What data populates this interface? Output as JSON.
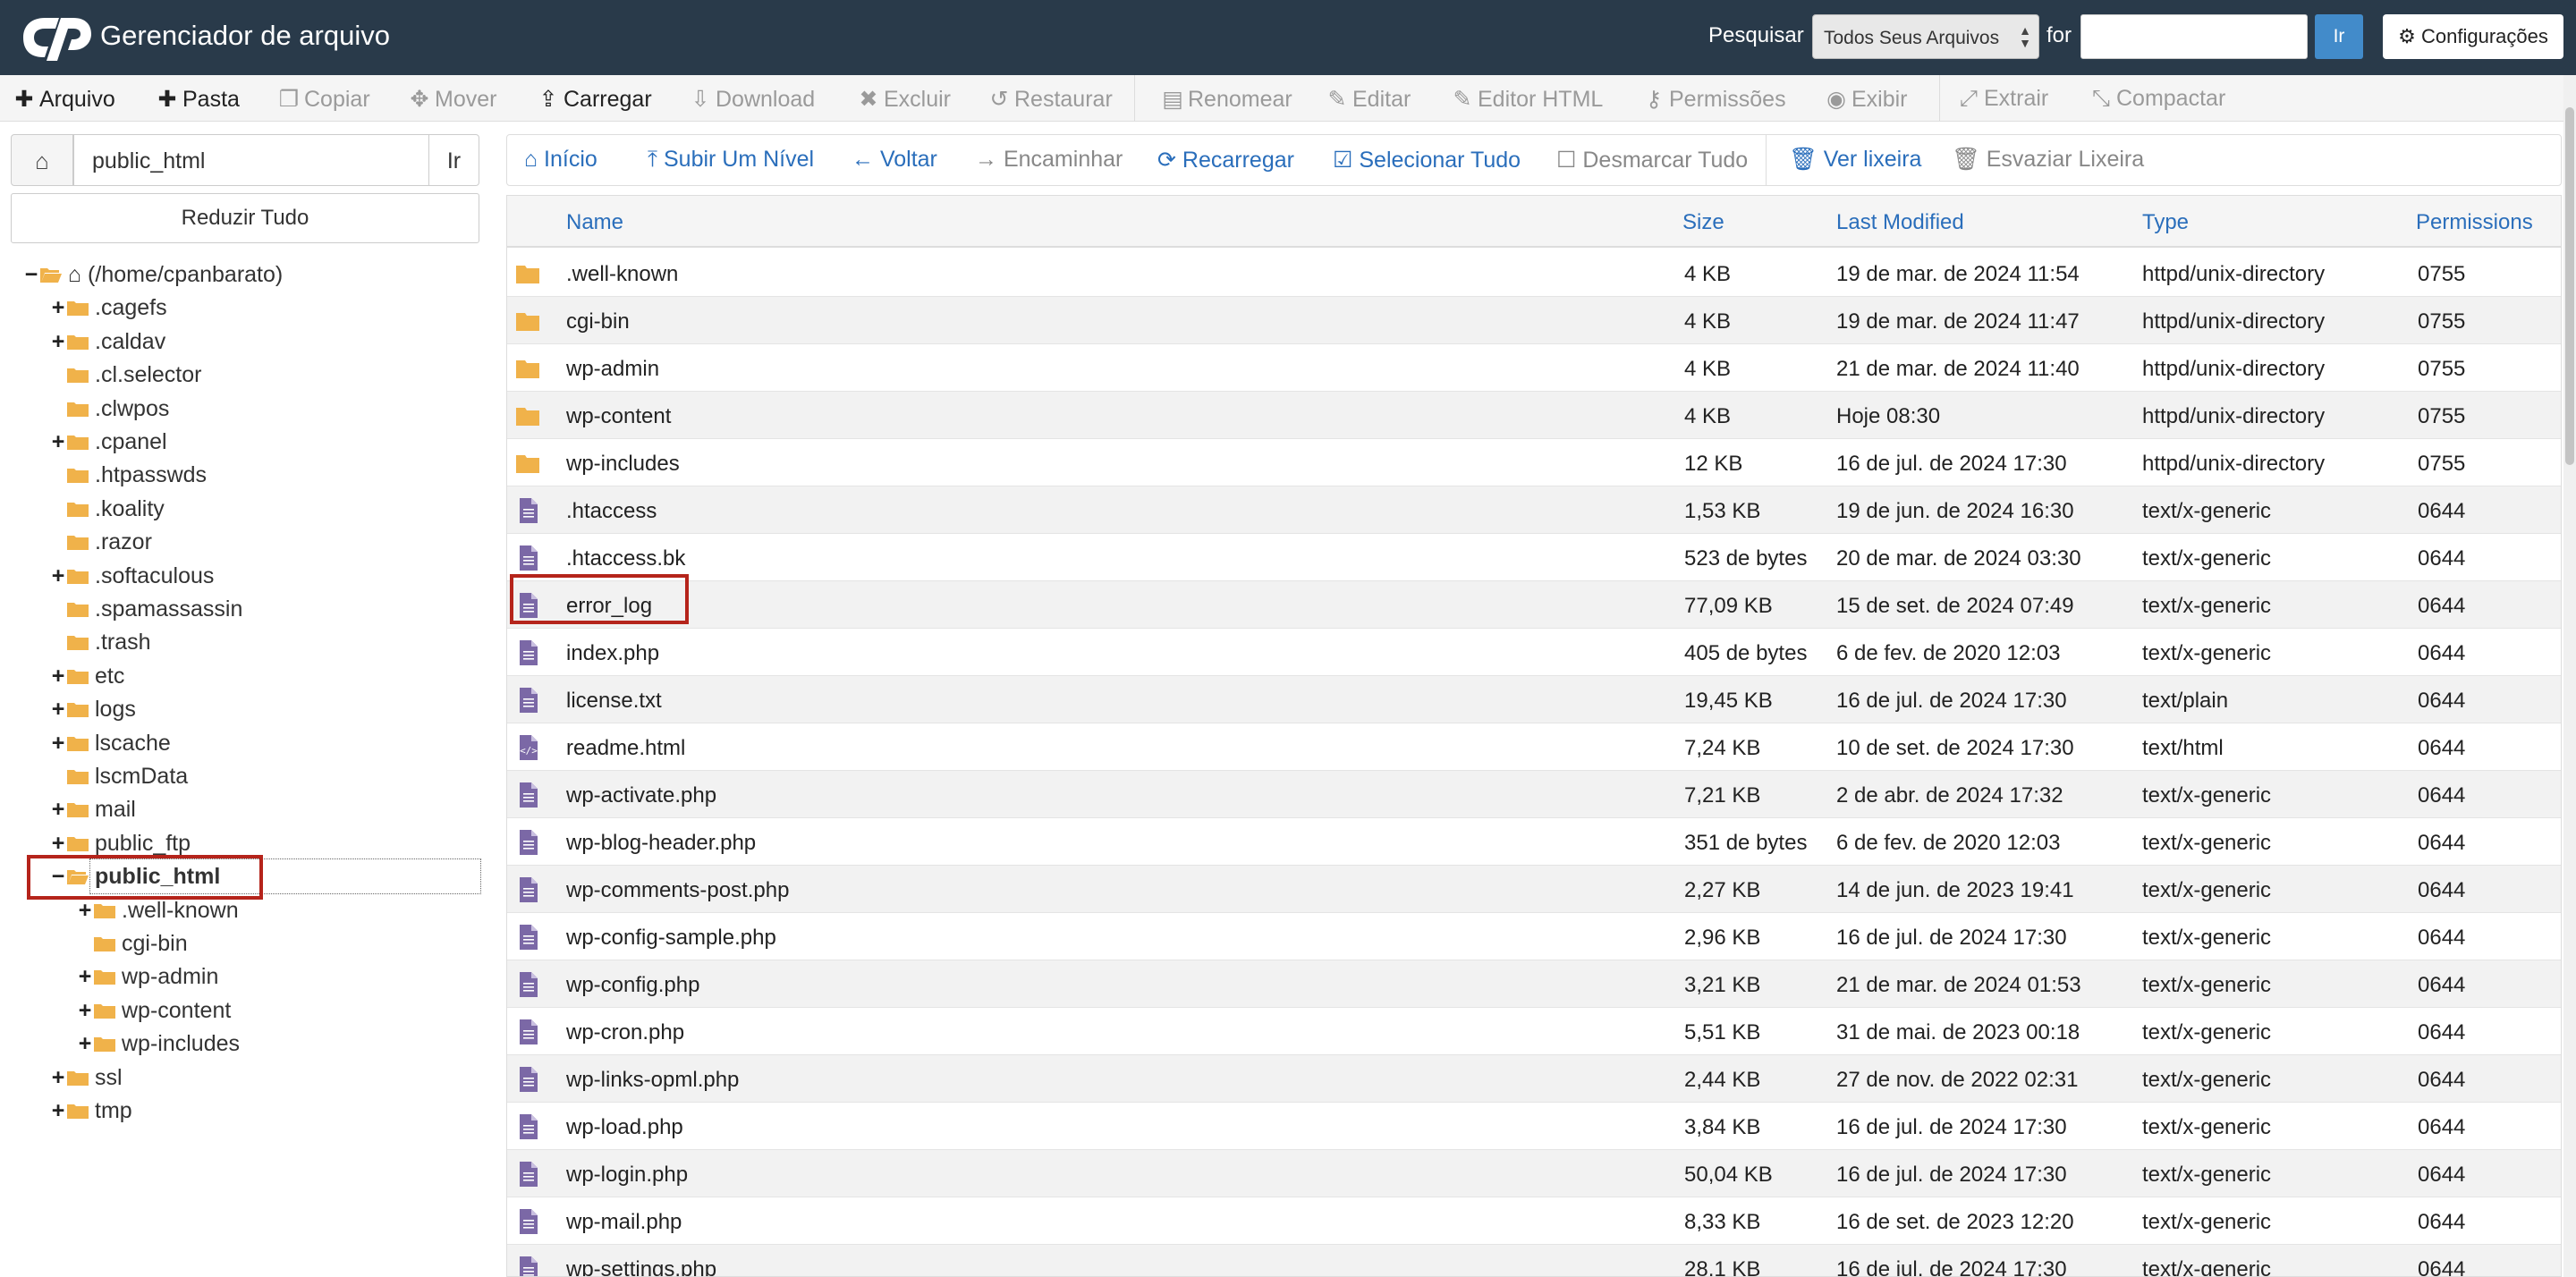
{
  "header": {
    "title": "Gerenciador de arquivo",
    "search_label": "Pesquisar",
    "search_scope": "Todos Seus Arquivos",
    "for_label": "for",
    "search_value": "",
    "go_label": "Ir",
    "settings_label": "Configurações"
  },
  "toolbar": {
    "items": [
      {
        "label": "Arquivo",
        "icon": "plus-icon",
        "enabled": true
      },
      {
        "label": "Pasta",
        "icon": "plus-icon",
        "enabled": true
      },
      {
        "label": "Copiar",
        "icon": "copy-icon",
        "enabled": false
      },
      {
        "label": "Mover",
        "icon": "move-icon",
        "enabled": false
      },
      {
        "label": "Carregar",
        "icon": "upload-icon",
        "enabled": true
      },
      {
        "label": "Download",
        "icon": "download-icon",
        "enabled": false
      },
      {
        "label": "Excluir",
        "icon": "delete-icon",
        "enabled": false
      },
      {
        "label": "Restaurar",
        "icon": "restore-icon",
        "enabled": false
      },
      {
        "label": "Renomear",
        "icon": "rename-icon",
        "enabled": false
      },
      {
        "label": "Editar",
        "icon": "pencil-icon",
        "enabled": false
      },
      {
        "label": "Editor HTML",
        "icon": "html-edit-icon",
        "enabled": false
      },
      {
        "label": "Permissões",
        "icon": "key-icon",
        "enabled": false
      },
      {
        "label": "Exibir",
        "icon": "eye-icon",
        "enabled": false
      },
      {
        "label": "Extrair",
        "icon": "extract-icon",
        "enabled": false
      },
      {
        "label": "Compactar",
        "icon": "compress-icon",
        "enabled": false
      }
    ]
  },
  "left": {
    "path_value": "public_html",
    "go_label": "Ir",
    "collapse_label": "Reduzir Tudo",
    "tree": [
      {
        "label": "(/home/cpanbarato)",
        "toggle": "−",
        "open": true,
        "home": true
      },
      {
        "label": ".cagefs",
        "toggle": "+"
      },
      {
        "label": ".caldav",
        "toggle": "+"
      },
      {
        "label": ".cl.selector",
        "toggle": ""
      },
      {
        "label": ".clwpos",
        "toggle": ""
      },
      {
        "label": ".cpanel",
        "toggle": "+"
      },
      {
        "label": ".htpasswds",
        "toggle": ""
      },
      {
        "label": ".koality",
        "toggle": ""
      },
      {
        "label": ".razor",
        "toggle": ""
      },
      {
        "label": ".softaculous",
        "toggle": "+"
      },
      {
        "label": ".spamassassin",
        "toggle": ""
      },
      {
        "label": ".trash",
        "toggle": ""
      },
      {
        "label": "etc",
        "toggle": "+"
      },
      {
        "label": "logs",
        "toggle": "+"
      },
      {
        "label": "lscache",
        "toggle": "+"
      },
      {
        "label": "lscmData",
        "toggle": ""
      },
      {
        "label": "mail",
        "toggle": "+"
      },
      {
        "label": "public_ftp",
        "toggle": "+"
      },
      {
        "label": "public_html",
        "toggle": "−",
        "open": true,
        "selected": true
      },
      {
        "label": ".well-known",
        "toggle": "+",
        "child": true
      },
      {
        "label": "cgi-bin",
        "toggle": "",
        "child": true
      },
      {
        "label": "wp-admin",
        "toggle": "+",
        "child": true
      },
      {
        "label": "wp-content",
        "toggle": "+",
        "child": true
      },
      {
        "label": "wp-includes",
        "toggle": "+",
        "child": true
      },
      {
        "label": "ssl",
        "toggle": "+"
      },
      {
        "label": "tmp",
        "toggle": "+"
      }
    ]
  },
  "nav": {
    "items": [
      {
        "label": "Início",
        "icon": "home-icon",
        "enabled": true
      },
      {
        "label": "Subir Um Nível",
        "icon": "level-up-icon",
        "enabled": true
      },
      {
        "label": "Voltar",
        "icon": "arrow-left-icon",
        "enabled": true
      },
      {
        "label": "Encaminhar",
        "icon": "arrow-right-icon",
        "enabled": false
      },
      {
        "label": "Recarregar",
        "icon": "refresh-icon",
        "enabled": true
      },
      {
        "label": "Selecionar Tudo",
        "icon": "checked-box-icon",
        "enabled": true
      },
      {
        "label": "Desmarcar Tudo",
        "icon": "empty-box-icon",
        "enabled": false
      },
      {
        "label": "Ver lixeira",
        "icon": "trash-icon",
        "enabled": true
      },
      {
        "label": "Esvaziar Lixeira",
        "icon": "trash-icon",
        "enabled": false
      }
    ]
  },
  "table": {
    "columns": [
      "Name",
      "Size",
      "Last Modified",
      "Type",
      "Permissions"
    ],
    "rows": [
      {
        "name": ".well-known",
        "size": "4 KB",
        "modified": "19 de mar. de 2024 11:54",
        "type": "httpd/unix-directory",
        "perms": "0755",
        "kind": "folder"
      },
      {
        "name": "cgi-bin",
        "size": "4 KB",
        "modified": "19 de mar. de 2024 11:47",
        "type": "httpd/unix-directory",
        "perms": "0755",
        "kind": "folder"
      },
      {
        "name": "wp-admin",
        "size": "4 KB",
        "modified": "21 de mar. de 2024 11:40",
        "type": "httpd/unix-directory",
        "perms": "0755",
        "kind": "folder"
      },
      {
        "name": "wp-content",
        "size": "4 KB",
        "modified": "Hoje 08:30",
        "type": "httpd/unix-directory",
        "perms": "0755",
        "kind": "folder"
      },
      {
        "name": "wp-includes",
        "size": "12 KB",
        "modified": "16 de jul. de 2024 17:30",
        "type": "httpd/unix-directory",
        "perms": "0755",
        "kind": "folder"
      },
      {
        "name": ".htaccess",
        "size": "1,53 KB",
        "modified": "19 de jun. de 2024 16:30",
        "type": "text/x-generic",
        "perms": "0644",
        "kind": "file"
      },
      {
        "name": ".htaccess.bk",
        "size": "523 de bytes",
        "modified": "20 de mar. de 2024 03:30",
        "type": "text/x-generic",
        "perms": "0644",
        "kind": "file"
      },
      {
        "name": "error_log",
        "size": "77,09 KB",
        "modified": "15 de set. de 2024 07:49",
        "type": "text/x-generic",
        "perms": "0644",
        "kind": "file"
      },
      {
        "name": "index.php",
        "size": "405 de bytes",
        "modified": "6 de fev. de 2020 12:03",
        "type": "text/x-generic",
        "perms": "0644",
        "kind": "file"
      },
      {
        "name": "license.txt",
        "size": "19,45 KB",
        "modified": "16 de jul. de 2024 17:30",
        "type": "text/plain",
        "perms": "0644",
        "kind": "file"
      },
      {
        "name": "readme.html",
        "size": "7,24 KB",
        "modified": "10 de set. de 2024 17:30",
        "type": "text/html",
        "perms": "0644",
        "kind": "html"
      },
      {
        "name": "wp-activate.php",
        "size": "7,21 KB",
        "modified": "2 de abr. de 2024 17:32",
        "type": "text/x-generic",
        "perms": "0644",
        "kind": "file"
      },
      {
        "name": "wp-blog-header.php",
        "size": "351 de bytes",
        "modified": "6 de fev. de 2020 12:03",
        "type": "text/x-generic",
        "perms": "0644",
        "kind": "file"
      },
      {
        "name": "wp-comments-post.php",
        "size": "2,27 KB",
        "modified": "14 de jun. de 2023 19:41",
        "type": "text/x-generic",
        "perms": "0644",
        "kind": "file"
      },
      {
        "name": "wp-config-sample.php",
        "size": "2,96 KB",
        "modified": "16 de jul. de 2024 17:30",
        "type": "text/x-generic",
        "perms": "0644",
        "kind": "file"
      },
      {
        "name": "wp-config.php",
        "size": "3,21 KB",
        "modified": "21 de mar. de 2024 01:53",
        "type": "text/x-generic",
        "perms": "0644",
        "kind": "file"
      },
      {
        "name": "wp-cron.php",
        "size": "5,51 KB",
        "modified": "31 de mai. de 2023 00:18",
        "type": "text/x-generic",
        "perms": "0644",
        "kind": "file"
      },
      {
        "name": "wp-links-opml.php",
        "size": "2,44 KB",
        "modified": "27 de nov. de 2022 02:31",
        "type": "text/x-generic",
        "perms": "0644",
        "kind": "file"
      },
      {
        "name": "wp-load.php",
        "size": "3,84 KB",
        "modified": "16 de jul. de 2024 17:30",
        "type": "text/x-generic",
        "perms": "0644",
        "kind": "file"
      },
      {
        "name": "wp-login.php",
        "size": "50,04 KB",
        "modified": "16 de jul. de 2024 17:30",
        "type": "text/x-generic",
        "perms": "0644",
        "kind": "file"
      },
      {
        "name": "wp-mail.php",
        "size": "8,33 KB",
        "modified": "16 de set. de 2023 12:20",
        "type": "text/x-generic",
        "perms": "0644",
        "kind": "file"
      },
      {
        "name": "wp-settings.php",
        "size": "28,1 KB",
        "modified": "16 de jul. de 2024 17:30",
        "type": "text/x-generic",
        "perms": "0644",
        "kind": "file"
      }
    ]
  },
  "colors": {
    "header_bg": "#293a4a",
    "link_blue": "#2a6ebb",
    "folder_yellow": "#f0b24a",
    "file_purple": "#7b68a6",
    "highlight_red": "#b5241b"
  }
}
